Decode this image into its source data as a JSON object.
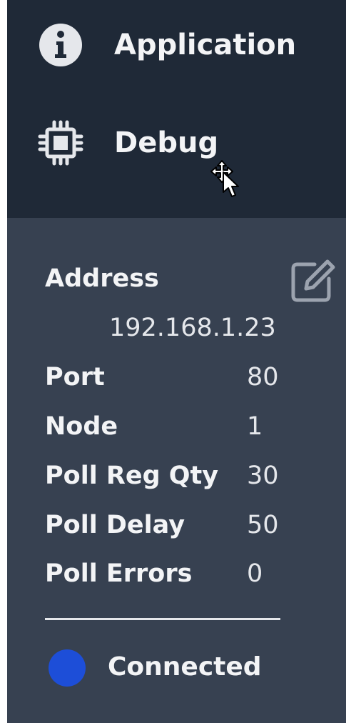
{
  "nav": {
    "items": [
      {
        "label": "Application",
        "icon": "info-circle-icon"
      },
      {
        "label": "Debug",
        "icon": "chip-icon"
      }
    ]
  },
  "connection": {
    "edit_icon": "edit-icon",
    "address_label": "Address",
    "address_value": "192.168.1.23",
    "rows": [
      {
        "label": "Port",
        "value": "80"
      },
      {
        "label": "Node",
        "value": "1"
      },
      {
        "label": "Poll Reg Qty",
        "value": "30"
      },
      {
        "label": "Poll Delay",
        "value": "50"
      },
      {
        "label": "Poll Errors",
        "value": "0"
      }
    ],
    "status": {
      "text": "Connected",
      "color": "#1d4ed8"
    }
  },
  "colors": {
    "nav_bg": "#1f2937",
    "panel_bg": "#374151",
    "text": "#f3f4f6"
  }
}
